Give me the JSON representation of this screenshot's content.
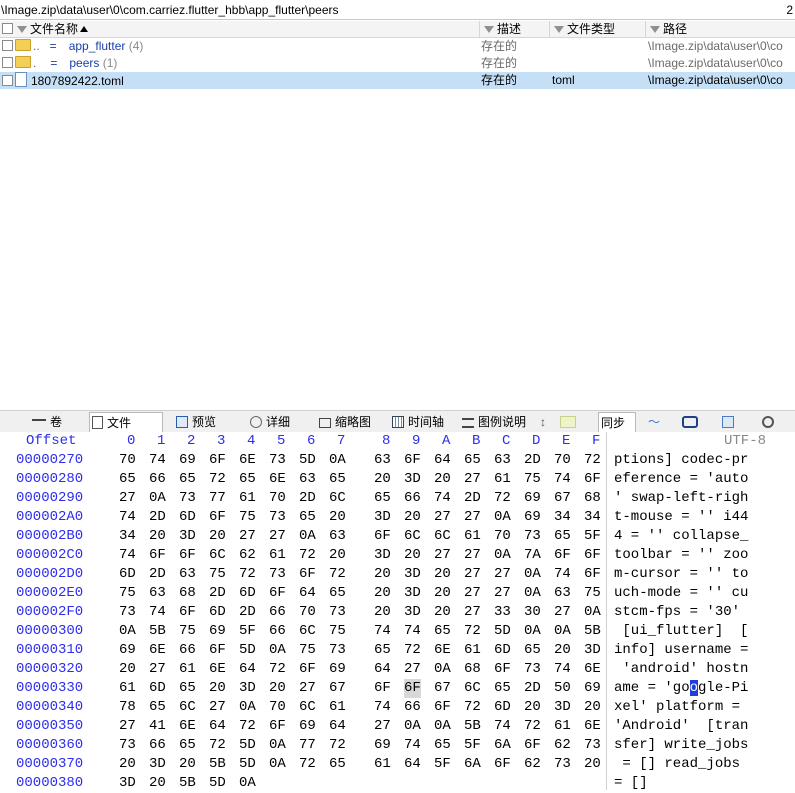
{
  "path_bar": {
    "path": "\\Image.zip\\data\\user\\0\\com.carriez.flutter_hbb\\app_flutter\\peers",
    "page_num": "2"
  },
  "list_header": {
    "name": "文件名称",
    "desc": "描述",
    "type": "文件类型",
    "path": "路径"
  },
  "rows": [
    {
      "name": "app_flutter",
      "count": "(4)",
      "prefix": "..",
      "eq": "=",
      "desc": "存在的",
      "type": "",
      "path": "\\Image.zip\\data\\user\\0\\co",
      "kind": "folder"
    },
    {
      "name": "peers",
      "count": "(1)",
      "prefix": ".",
      "eq": "=",
      "desc": "存在的",
      "type": "",
      "path": "\\Image.zip\\data\\user\\0\\co",
      "kind": "folder"
    },
    {
      "name": "1807892422.toml",
      "count": "",
      "prefix": "",
      "eq": "",
      "desc": "存在的",
      "type": "toml",
      "path": "\\Image.zip\\data\\user\\0\\co",
      "kind": "file"
    }
  ],
  "toolbar": {
    "juan": "卷",
    "file": "文件",
    "preview": "预览",
    "detail": "详细",
    "thumb": "缩略图",
    "timeline": "时间轴",
    "legend": "图例说明",
    "sync": "同步"
  },
  "hex": {
    "offset_label": "Offset",
    "encoding": "UTF-8",
    "columns": [
      "0",
      "1",
      "2",
      "3",
      "4",
      "5",
      "6",
      "7",
      "8",
      "9",
      "A",
      "B",
      "C",
      "D",
      "E",
      "F"
    ],
    "lines": [
      {
        "offset": "00000270",
        "bytes": [
          "70",
          "74",
          "69",
          "6F",
          "6E",
          "73",
          "5D",
          "0A",
          "63",
          "6F",
          "64",
          "65",
          "63",
          "2D",
          "70",
          "72"
        ],
        "ascii": "ptions] codec-pr"
      },
      {
        "offset": "00000280",
        "bytes": [
          "65",
          "66",
          "65",
          "72",
          "65",
          "6E",
          "63",
          "65",
          "20",
          "3D",
          "20",
          "27",
          "61",
          "75",
          "74",
          "6F"
        ],
        "ascii": "eference = 'auto"
      },
      {
        "offset": "00000290",
        "bytes": [
          "27",
          "0A",
          "73",
          "77",
          "61",
          "70",
          "2D",
          "6C",
          "65",
          "66",
          "74",
          "2D",
          "72",
          "69",
          "67",
          "68"
        ],
        "ascii": "' swap-left-righ"
      },
      {
        "offset": "000002A0",
        "bytes": [
          "74",
          "2D",
          "6D",
          "6F",
          "75",
          "73",
          "65",
          "20",
          "3D",
          "20",
          "27",
          "27",
          "0A",
          "69",
          "34",
          "34"
        ],
        "ascii": "t-mouse = '' i44"
      },
      {
        "offset": "000002B0",
        "bytes": [
          "34",
          "20",
          "3D",
          "20",
          "27",
          "27",
          "0A",
          "63",
          "6F",
          "6C",
          "6C",
          "61",
          "70",
          "73",
          "65",
          "5F"
        ],
        "ascii": "4 = '' collapse_"
      },
      {
        "offset": "000002C0",
        "bytes": [
          "74",
          "6F",
          "6F",
          "6C",
          "62",
          "61",
          "72",
          "20",
          "3D",
          "20",
          "27",
          "27",
          "0A",
          "7A",
          "6F",
          "6F"
        ],
        "ascii": "toolbar = '' zoo"
      },
      {
        "offset": "000002D0",
        "bytes": [
          "6D",
          "2D",
          "63",
          "75",
          "72",
          "73",
          "6F",
          "72",
          "20",
          "3D",
          "20",
          "27",
          "27",
          "0A",
          "74",
          "6F"
        ],
        "ascii": "m-cursor = '' to"
      },
      {
        "offset": "000002E0",
        "bytes": [
          "75",
          "63",
          "68",
          "2D",
          "6D",
          "6F",
          "64",
          "65",
          "20",
          "3D",
          "20",
          "27",
          "27",
          "0A",
          "63",
          "75"
        ],
        "ascii": "uch-mode = '' cu"
      },
      {
        "offset": "000002F0",
        "bytes": [
          "73",
          "74",
          "6F",
          "6D",
          "2D",
          "66",
          "70",
          "73",
          "20",
          "3D",
          "20",
          "27",
          "33",
          "30",
          "27",
          "0A"
        ],
        "ascii": "stcm-fps = '30'"
      },
      {
        "offset": "00000300",
        "bytes": [
          "0A",
          "5B",
          "75",
          "69",
          "5F",
          "66",
          "6C",
          "75",
          "74",
          "74",
          "65",
          "72",
          "5D",
          "0A",
          "0A",
          "5B"
        ],
        "ascii": " [ui_flutter]  ["
      },
      {
        "offset": "00000310",
        "bytes": [
          "69",
          "6E",
          "66",
          "6F",
          "5D",
          "0A",
          "75",
          "73",
          "65",
          "72",
          "6E",
          "61",
          "6D",
          "65",
          "20",
          "3D"
        ],
        "ascii": "info] username ="
      },
      {
        "offset": "00000320",
        "bytes": [
          "20",
          "27",
          "61",
          "6E",
          "64",
          "72",
          "6F",
          "69",
          "64",
          "27",
          "0A",
          "68",
          "6F",
          "73",
          "74",
          "6E"
        ],
        "ascii": " 'android' hostn"
      },
      {
        "offset": "00000330",
        "bytes": [
          "61",
          "6D",
          "65",
          "20",
          "3D",
          "20",
          "27",
          "67",
          "6F",
          "6F",
          "67",
          "6C",
          "65",
          "2D",
          "50",
          "69"
        ],
        "ascii_pre": "ame = 'go",
        "ascii_hl": "o",
        "ascii_post": "gle-Pi"
      },
      {
        "offset": "00000340",
        "bytes": [
          "78",
          "65",
          "6C",
          "27",
          "0A",
          "70",
          "6C",
          "61",
          "74",
          "66",
          "6F",
          "72",
          "6D",
          "20",
          "3D",
          "20"
        ],
        "ascii": "xel' platform = "
      },
      {
        "offset": "00000350",
        "bytes": [
          "27",
          "41",
          "6E",
          "64",
          "72",
          "6F",
          "69",
          "64",
          "27",
          "0A",
          "0A",
          "5B",
          "74",
          "72",
          "61",
          "6E"
        ],
        "ascii": "'Android'  [tran"
      },
      {
        "offset": "00000360",
        "bytes": [
          "73",
          "66",
          "65",
          "72",
          "5D",
          "0A",
          "77",
          "72",
          "69",
          "74",
          "65",
          "5F",
          "6A",
          "6F",
          "62",
          "73"
        ],
        "ascii": "sfer] write_jobs"
      },
      {
        "offset": "00000370",
        "bytes": [
          "20",
          "3D",
          "20",
          "5B",
          "5D",
          "0A",
          "72",
          "65",
          "61",
          "64",
          "5F",
          "6A",
          "6F",
          "62",
          "73",
          "20"
        ],
        "ascii": " = [] read_jobs "
      },
      {
        "offset": "00000380",
        "bytes": [
          "3D",
          "20",
          "5B",
          "5D",
          "0A",
          "",
          "",
          "",
          "",
          "",
          "",
          "",
          "",
          "",
          "",
          ""
        ],
        "ascii": "= []"
      }
    ]
  }
}
